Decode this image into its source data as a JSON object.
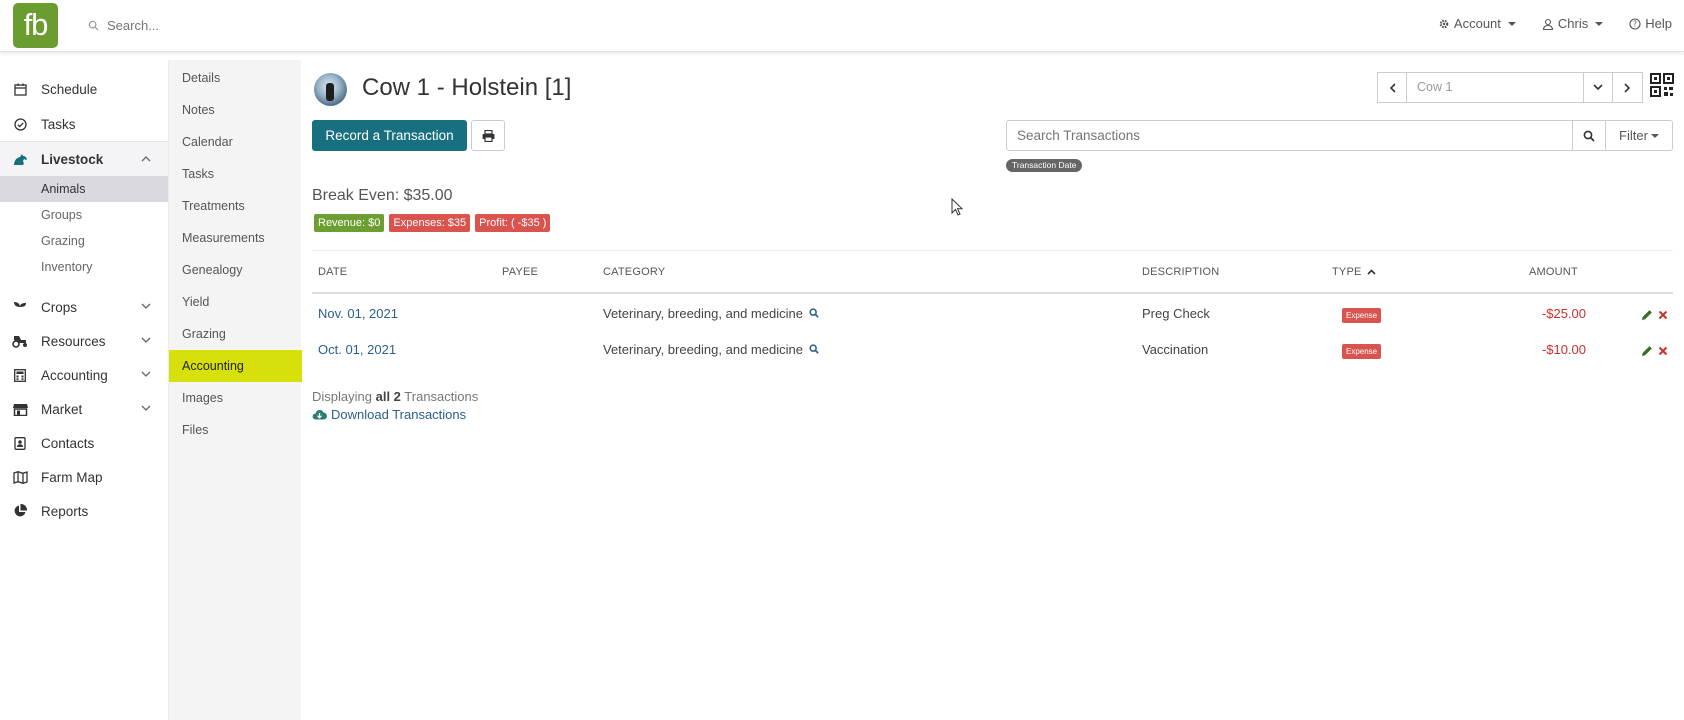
{
  "topbar": {
    "logo": "fb",
    "search_placeholder": "Search...",
    "account": "Account",
    "user": "Chris",
    "help": "Help"
  },
  "leftnav": {
    "items": [
      {
        "label": "Schedule",
        "icon": "calendar-icon"
      },
      {
        "label": "Tasks",
        "icon": "check-circle-icon"
      },
      {
        "label": "Livestock",
        "icon": "horse-icon"
      },
      {
        "label": "Crops",
        "icon": "seedling-icon"
      },
      {
        "label": "Resources",
        "icon": "tractor-icon"
      },
      {
        "label": "Accounting",
        "icon": "calculator-icon"
      },
      {
        "label": "Market",
        "icon": "store-icon"
      },
      {
        "label": "Contacts",
        "icon": "address-book-icon"
      },
      {
        "label": "Farm Map",
        "icon": "map-icon"
      },
      {
        "label": "Reports",
        "icon": "pie-chart-icon"
      }
    ],
    "livestock_sub": [
      "Animals",
      "Groups",
      "Grazing",
      "Inventory"
    ]
  },
  "subnav": [
    "Details",
    "Notes",
    "Calendar",
    "Tasks",
    "Treatments",
    "Measurements",
    "Genealogy",
    "Yield",
    "Grazing",
    "Accounting",
    "Images",
    "Files"
  ],
  "header": {
    "title": "Cow 1 - Holstein [1]",
    "pager_value": "Cow 1"
  },
  "actions": {
    "record": "Record a Transaction",
    "search_placeholder": "Search Transactions",
    "filter": "Filter",
    "date_pill": "Transaction Date"
  },
  "summary": {
    "break_even": "Break Even: $35.00",
    "revenue": "Revenue: $0",
    "expenses": "Expenses: $35",
    "profit": "Profit: ( -$35 )"
  },
  "table": {
    "headers": [
      "DATE",
      "PAYEE",
      "CATEGORY",
      "DESCRIPTION",
      "TYPE",
      "AMOUNT"
    ],
    "rows": [
      {
        "date": "Nov. 01, 2021",
        "payee": "",
        "category": "Veterinary, breeding, and medicine",
        "description": "Preg Check",
        "type": "Expense",
        "amount": "-$25.00"
      },
      {
        "date": "Oct. 01, 2021",
        "payee": "",
        "category": "Veterinary, breeding, and medicine",
        "description": "Vaccination",
        "type": "Expense",
        "amount": "-$10.00"
      }
    ]
  },
  "footer": {
    "displaying_prefix": "Displaying",
    "displaying_bold": "all 2",
    "displaying_suffix": "Transactions",
    "download": "Download Transactions"
  },
  "colors": {
    "brand": "#6b9c2f",
    "primary": "#176f7f",
    "highlight": "#d8e00b",
    "danger": "#d9534f"
  }
}
